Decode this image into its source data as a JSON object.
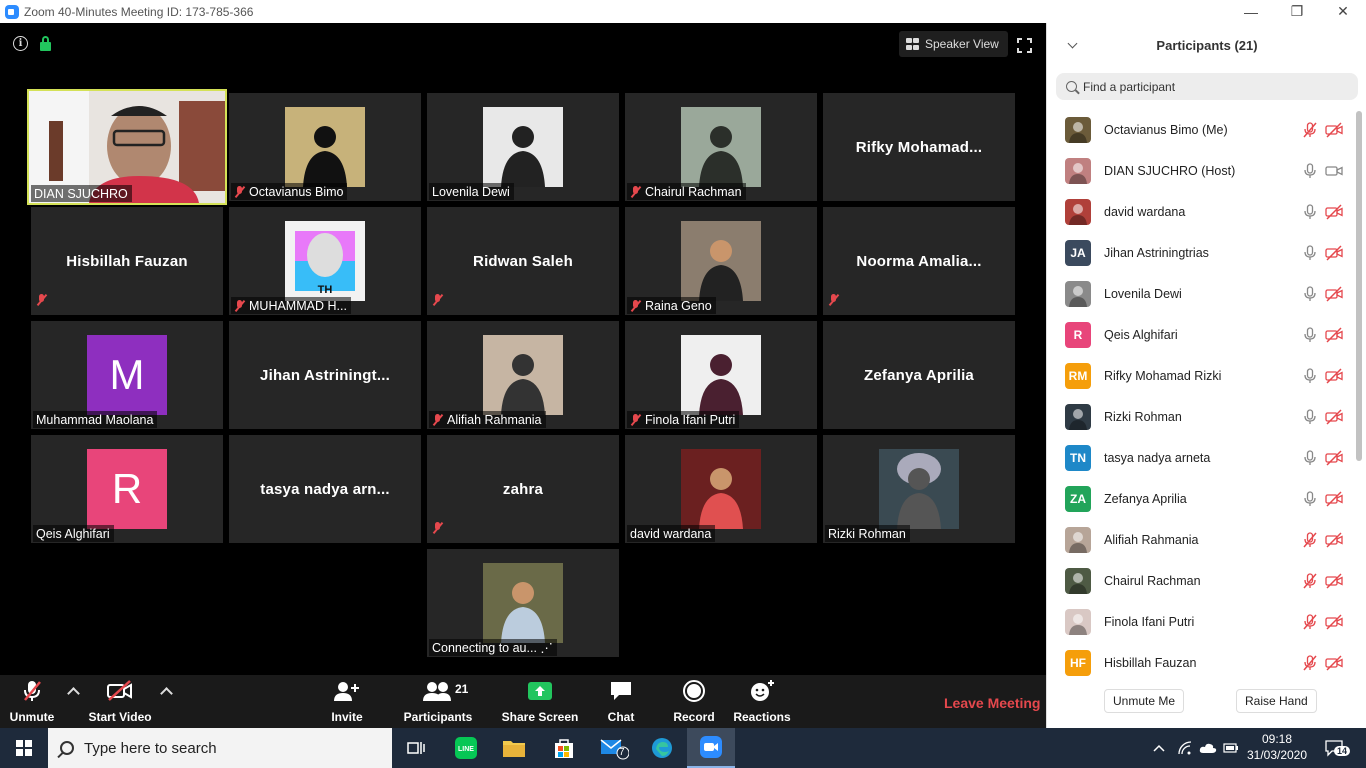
{
  "window": {
    "title": "Zoom 40-Minutes Meeting ID: 173-785-366",
    "minimize": "—",
    "maximize": "❐",
    "close": "✕"
  },
  "meeting": {
    "speaker_view_label": "Speaker View",
    "info_icon": "i",
    "tiles": [
      {
        "name": "DIAN SJUCHRO",
        "type": "video",
        "muted": false,
        "active": true
      },
      {
        "name": "Octavianus Bimo",
        "type": "photo",
        "muted": true
      },
      {
        "name": "Lovenila Dewi",
        "type": "photo",
        "muted": false
      },
      {
        "name": "Chairul Rachman",
        "type": "photo",
        "muted": true
      },
      {
        "name": "Rifky  Mohamad...",
        "type": "name",
        "muted": false
      },
      {
        "name": "Hisbillah Fauzan",
        "type": "name",
        "muted": true
      },
      {
        "name": "MUHAMMAD H...",
        "type": "photo",
        "muted": true
      },
      {
        "name": "Ridwan Saleh",
        "type": "name",
        "muted": true
      },
      {
        "name": "Raina Geno",
        "type": "photo",
        "muted": true
      },
      {
        "name": "Noorma  Amalia...",
        "type": "name",
        "muted": true
      },
      {
        "name": "Muhammad Maolana",
        "type": "initial",
        "initial": "M",
        "muted": false
      },
      {
        "name": "Jihan  Astriningt...",
        "type": "name",
        "muted": false
      },
      {
        "name": "Alifiah Rahmania",
        "type": "photo",
        "muted": true
      },
      {
        "name": "Finola Ifani Putri",
        "type": "photo",
        "muted": true
      },
      {
        "name": "Zefanya Aprilia",
        "type": "name",
        "muted": false
      },
      {
        "name": "Qeis Alghifari",
        "type": "initial",
        "initial": "R",
        "muted": false
      },
      {
        "name": "tasya  nadya  arn...",
        "type": "name",
        "muted": false
      },
      {
        "name": "zahra",
        "type": "name",
        "muted": true
      },
      {
        "name": "david wardana",
        "type": "photo",
        "muted": false
      },
      {
        "name": "Rizki Rohman",
        "type": "photo",
        "muted": false
      },
      {
        "name": "Connecting to au... ⋰",
        "type": "photo",
        "muted": false
      }
    ]
  },
  "toolbar": {
    "unmute": "Unmute",
    "start_video": "Start Video",
    "invite": "Invite",
    "participants": "Participants",
    "participants_count": "21",
    "share_screen": "Share Screen",
    "chat": "Chat",
    "record": "Record",
    "reactions": "Reactions",
    "leave": "Leave Meeting"
  },
  "panel": {
    "title": "Participants (21)",
    "search_placeholder": "Find a participant",
    "participants": [
      {
        "name": "Octavianus Bimo (Me)",
        "avatar": "photo",
        "color": "#6b5b3a",
        "mic": "muted",
        "cam": "off"
      },
      {
        "name": "DIAN SJUCHRO (Host)",
        "avatar": "photo",
        "color": "#c08080",
        "mic": "on",
        "cam": "on"
      },
      {
        "name": "david wardana",
        "avatar": "photo",
        "color": "#b0403a",
        "mic": "on",
        "cam": "off"
      },
      {
        "name": "Jihan Astriningtrias",
        "avatar": "initials",
        "initials": "JA",
        "color": "#3b4a5e",
        "mic": "on",
        "cam": "off"
      },
      {
        "name": "Lovenila Dewi",
        "avatar": "photo",
        "color": "#8a8a8a",
        "mic": "on",
        "cam": "off"
      },
      {
        "name": "Qeis Alghifari",
        "avatar": "initials",
        "initials": "R",
        "color": "#e8457a",
        "mic": "on",
        "cam": "off"
      },
      {
        "name": "Rifky Mohamad Rizki",
        "avatar": "initials",
        "initials": "RM",
        "color": "#f59e0b",
        "mic": "on",
        "cam": "off"
      },
      {
        "name": "Rizki Rohman",
        "avatar": "photo",
        "color": "#2f3b45",
        "mic": "on",
        "cam": "off"
      },
      {
        "name": "tasya nadya arneta",
        "avatar": "initials",
        "initials": "TN",
        "color": "#1e88c8",
        "mic": "on",
        "cam": "off"
      },
      {
        "name": "Zefanya Aprilia",
        "avatar": "initials",
        "initials": "ZA",
        "color": "#22a45a",
        "mic": "on",
        "cam": "off"
      },
      {
        "name": "Alifiah Rahmania",
        "avatar": "photo",
        "color": "#b7a598",
        "mic": "muted",
        "cam": "off"
      },
      {
        "name": "Chairul Rachman",
        "avatar": "photo",
        "color": "#4e5a44",
        "mic": "muted",
        "cam": "off"
      },
      {
        "name": "Finola Ifani Putri",
        "avatar": "photo",
        "color": "#d9c8c4",
        "mic": "muted",
        "cam": "off"
      },
      {
        "name": "Hisbillah Fauzan",
        "avatar": "initials",
        "initials": "HF",
        "color": "#f59e0b",
        "mic": "muted",
        "cam": "off"
      }
    ],
    "unmute_me": "Unmute Me",
    "raise_hand": "Raise Hand"
  },
  "taskbar": {
    "search_placeholder": "Type here to search",
    "time": "09:18",
    "date": "31/03/2020",
    "notifications": "14",
    "mail_badge": "7"
  }
}
